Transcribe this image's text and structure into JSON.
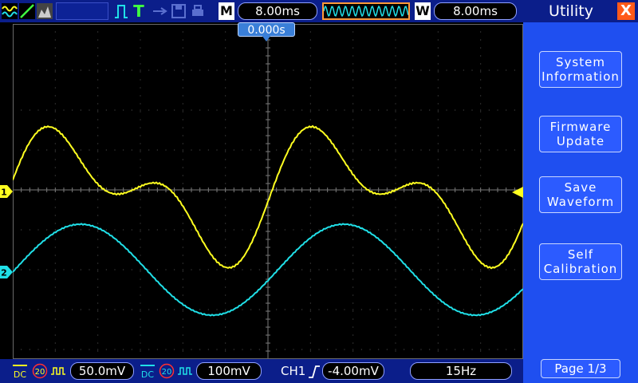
{
  "topbar": {
    "timebase_letter": "M",
    "timebase_value": "8.00ms",
    "window_letter": "W",
    "window_value": "8.00ms",
    "trigger_mode_letter": "T"
  },
  "screen": {
    "trigger_position": "0.000s"
  },
  "channels": [
    {
      "marker": "1",
      "color": "#ffff20"
    },
    {
      "marker": "2",
      "color": "#20e0e8"
    }
  ],
  "bottombar": {
    "ch1_coupling": "DC",
    "ch1_bw": "20",
    "ch1_scale": "50.0mV",
    "ch2_coupling": "DC",
    "ch2_bw": "20",
    "ch2_scale": "100mV",
    "trigger_source": "CH1",
    "trigger_level": "-4.00mV",
    "frequency": "15Hz"
  },
  "menu": {
    "title": "Utility",
    "close_glyph": "X",
    "items": [
      {
        "line1": "System",
        "line2": "Information"
      },
      {
        "line1": "Firmware",
        "line2": "Update"
      },
      {
        "line1": "Save",
        "line2": "Waveform"
      },
      {
        "line1": "Self",
        "line2": "Calibration"
      }
    ],
    "page": "Page 1/3"
  },
  "colors": {
    "ch1": "#ffff20",
    "ch2": "#20e0e8",
    "bar": "#0b1e8a",
    "menu": "#1f4ff0",
    "close": "#ff5a1a"
  }
}
